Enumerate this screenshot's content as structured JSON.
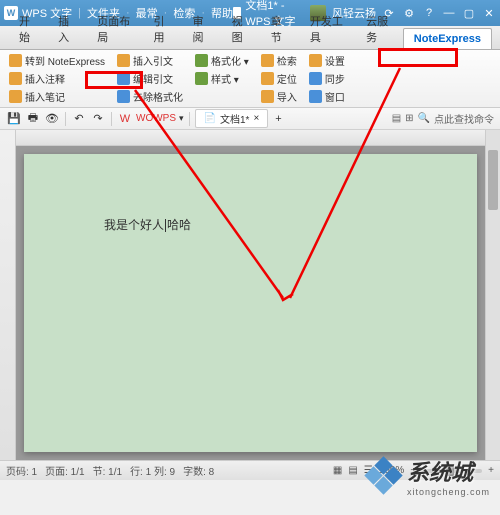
{
  "titlebar": {
    "app": "WPS 文字",
    "doc_title": "文档1* - WPS 文字",
    "user": "风轻云扬",
    "menu_items": [
      "文件夹",
      "最常",
      "检索",
      "帮助"
    ]
  },
  "tabs": {
    "items": [
      "开始",
      "插入",
      "页面布局",
      "引用",
      "审阅",
      "视图",
      "章节",
      "开发工具",
      "云服务",
      "NoteExpress"
    ]
  },
  "ribbon": {
    "col1": [
      {
        "icon": "#e7a23c",
        "label": "转到 NoteExpress"
      },
      {
        "icon": "#e7a23c",
        "label": "插入注释"
      },
      {
        "icon": "#e7a23c",
        "label": "插入笔记"
      }
    ],
    "col2": [
      {
        "icon": "#e7a23c",
        "label": "插入引文"
      },
      {
        "icon": "#4a90d9",
        "label": "编辑引文"
      },
      {
        "icon": "#4a90d9",
        "label": "去除格式化"
      }
    ],
    "col3": [
      {
        "icon": "#6b9e3f",
        "label": "格式化  ▾"
      },
      {
        "icon": "#6b9e3f",
        "label": "样式  ▾"
      }
    ],
    "col4": [
      {
        "icon": "#e7a23c",
        "label": "检索"
      },
      {
        "icon": "#e7a23c",
        "label": "定位"
      },
      {
        "icon": "#e7a23c",
        "label": "导入"
      }
    ],
    "col5": [
      {
        "icon": "#e7a23c",
        "label": "设置"
      },
      {
        "icon": "#4a90d9",
        "label": "同步"
      },
      {
        "icon": "#4a90d9",
        "label": "窗口"
      }
    ]
  },
  "qat": {
    "doc_tab": "文档1*",
    "search_placeholder": "点此查找命令",
    "wps_btn": "WOWPS"
  },
  "document": {
    "text_before": "我是个好人",
    "text_after": "哈哈"
  },
  "statusbar": {
    "page": "页码: 1",
    "pages": "页面: 1/1",
    "section": "节: 1/1",
    "pos": "行: 1 列: 9",
    "chars": "字数: 8",
    "zoom": "100%"
  },
  "watermark": {
    "text": "系统城",
    "sub": "xitongcheng.com"
  }
}
